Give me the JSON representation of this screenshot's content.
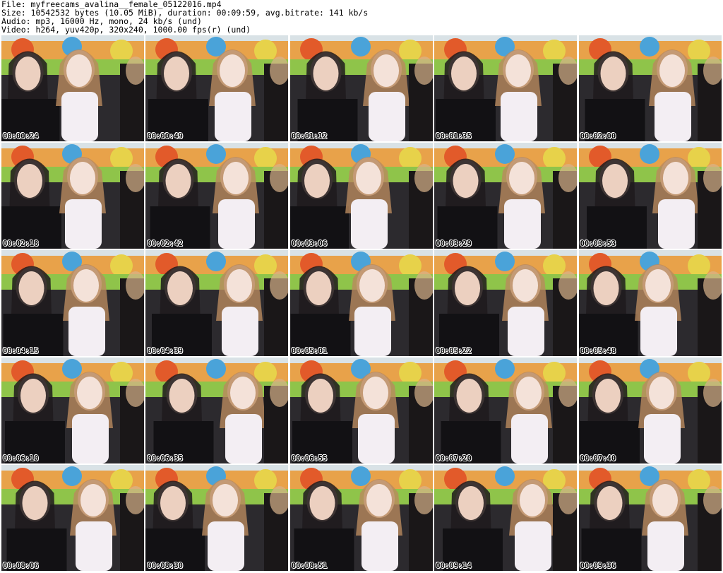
{
  "header": {
    "file_line": "File: myfreecams_avalina__female_05122016.mp4",
    "size_line": "Size: 10542532 bytes (10.05 MiB), duration: 00:09:59, avg.bitrate: 141 kb/s",
    "audio_line": "Audio: mp3, 16000 Hz, mono, 24 kb/s (und)",
    "video_line": "Video: h264, yuv420p, 320x240, 1000.00 fps(r) (und)"
  },
  "thumbnails": [
    {
      "timestamp": "00:00:24"
    },
    {
      "timestamp": "00:00:49"
    },
    {
      "timestamp": "00:01:12"
    },
    {
      "timestamp": "00:01:35"
    },
    {
      "timestamp": "00:02:00"
    },
    {
      "timestamp": "00:02:18"
    },
    {
      "timestamp": "00:02:42"
    },
    {
      "timestamp": "00:03:06"
    },
    {
      "timestamp": "00:03:29"
    },
    {
      "timestamp": "00:03:53"
    },
    {
      "timestamp": "00:04:15"
    },
    {
      "timestamp": "00:04:39"
    },
    {
      "timestamp": "00:05:01"
    },
    {
      "timestamp": "00:05:22"
    },
    {
      "timestamp": "00:05:48"
    },
    {
      "timestamp": "00:06:10"
    },
    {
      "timestamp": "00:06:35"
    },
    {
      "timestamp": "00:06:55"
    },
    {
      "timestamp": "00:07:20"
    },
    {
      "timestamp": "00:07:40"
    },
    {
      "timestamp": "00:08:06"
    },
    {
      "timestamp": "00:08:30"
    },
    {
      "timestamp": "00:08:51"
    },
    {
      "timestamp": "00:09:14"
    },
    {
      "timestamp": "00:09:36"
    }
  ]
}
